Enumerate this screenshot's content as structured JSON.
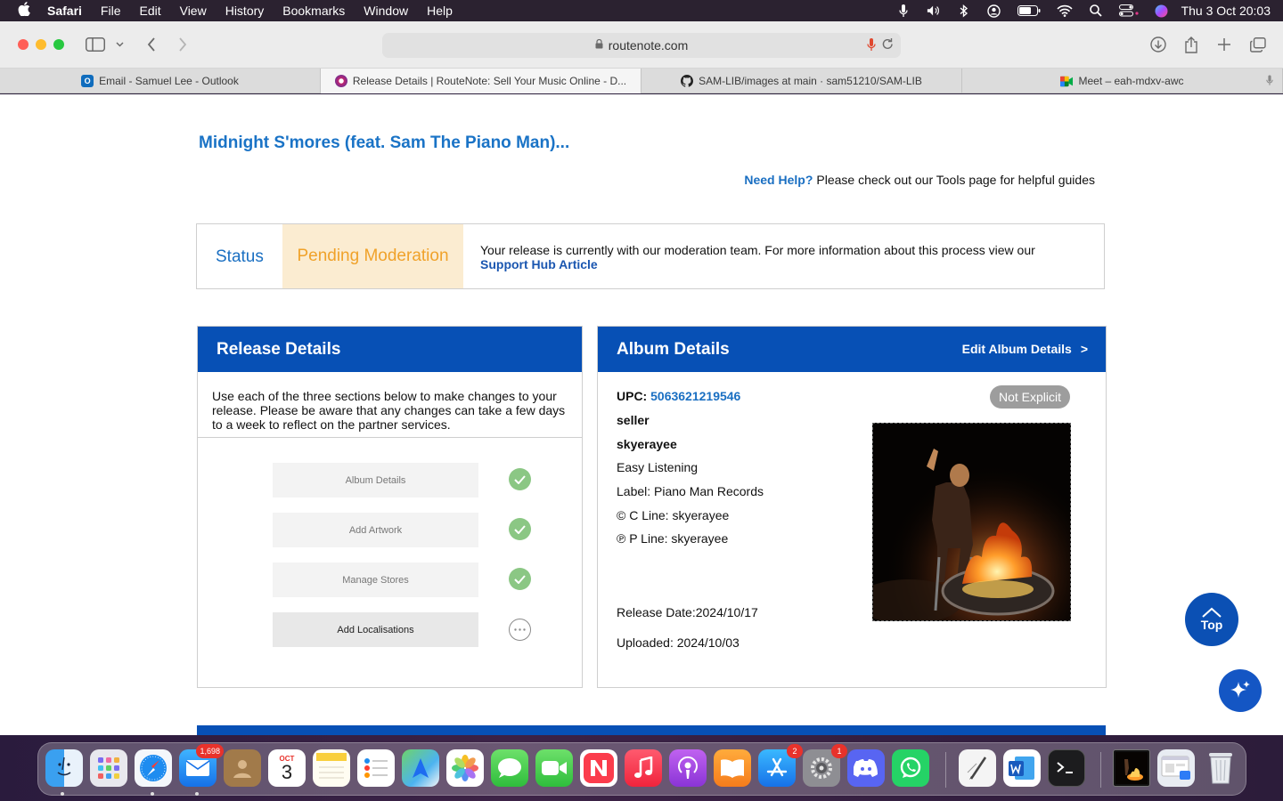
{
  "menubar": {
    "app": "Safari",
    "items": [
      "File",
      "Edit",
      "View",
      "History",
      "Bookmarks",
      "Window",
      "Help"
    ],
    "clock": "Thu 3 Oct  20:03",
    "status_icons": [
      "microphone-icon",
      "volume-icon",
      "bluetooth-icon",
      "user-icon",
      "battery-icon",
      "wifi-icon",
      "spotlight-icon",
      "control-center-icon",
      "siri-icon"
    ]
  },
  "browser": {
    "url": "routenote.com",
    "tabs": [
      {
        "label": "Email - Samuel Lee - Outlook",
        "icon": "outlook-icon",
        "active": false
      },
      {
        "label": "Release Details | RouteNote: Sell Your Music Online - D...",
        "icon": "routenote-icon",
        "active": true
      },
      {
        "label": "SAM-LIB/images at main · sam51210/SAM-LIB",
        "icon": "github-icon",
        "active": false
      },
      {
        "label": "Meet – eah-mdxv-awc",
        "icon": "meet-icon",
        "active": false
      }
    ]
  },
  "page": {
    "release_title": "Midnight S'mores (feat. Sam The Piano Man)...",
    "help": {
      "link": "Need Help?",
      "text": "Please check out our Tools page for helpful guides"
    },
    "status": {
      "label": "Status",
      "value": "Pending Moderation",
      "message": "Your release is currently with our moderation team. For more information about this process view our",
      "link": "Support Hub Article"
    },
    "release_details": {
      "heading": "Release Details",
      "intro": "Use each of the three sections below to make changes to your release. Please be aware that any changes can take a few days to a week to reflect on the partner services.",
      "steps": [
        {
          "label": "Album Details",
          "complete": true
        },
        {
          "label": "Add Artwork",
          "complete": true
        },
        {
          "label": "Manage Stores",
          "complete": true
        },
        {
          "label": "Add Localisations",
          "complete": false
        }
      ]
    },
    "album_details": {
      "heading": "Album Details",
      "edit_link": "Edit Album Details",
      "edit_chevron": ">",
      "upc_label": "UPC:",
      "upc": "5063621219546",
      "seller": "seller",
      "artist": "skyerayee",
      "genre": "Easy Listening",
      "label": "Label: Piano Man Records",
      "c_line": "© C Line: skyerayee",
      "p_line": "℗ P Line: skyerayee",
      "release_date": "Release Date:2024/10/17",
      "uploaded": "Uploaded: 2024/10/03",
      "explicit": "Not Explicit"
    },
    "top_button": "Top"
  },
  "dock": {
    "mail_badge": "1,698",
    "calendar_month": "OCT",
    "calendar_day": "3",
    "appstore_badge": "2",
    "settings_badge": "1"
  },
  "colors": {
    "brand_blue": "#0750b5",
    "link_blue": "#1a6fc2",
    "pending_bg": "#fbecd1",
    "pending_text": "#f0a22a",
    "check_green": "#8bc784"
  }
}
